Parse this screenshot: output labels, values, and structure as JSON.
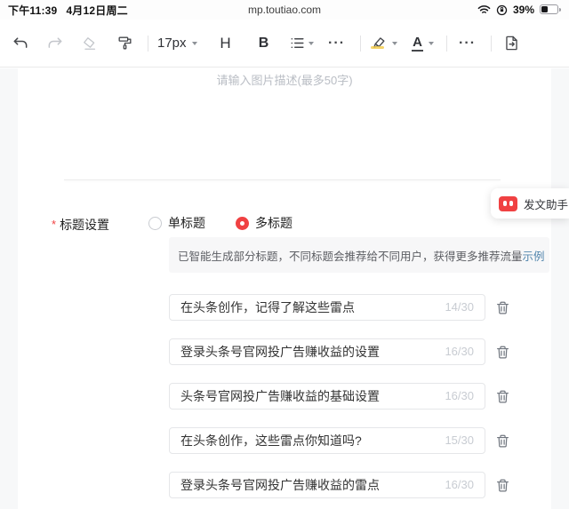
{
  "status_bar": {
    "time": "下午11:39",
    "date": "4月12日周二",
    "url": "mp.toutiao.com",
    "battery_percent": "39%"
  },
  "toolbar": {
    "font_size": "17px",
    "heading_label": "H",
    "bold_label": "B",
    "text_color_label": "A",
    "more_label": "···"
  },
  "editor": {
    "image_caption_placeholder": "请输入图片描述(最多50字)"
  },
  "title_settings": {
    "required_mark": "*",
    "label": "标题设置",
    "options": [
      {
        "label": "单标题",
        "selected": false
      },
      {
        "label": "多标题",
        "selected": true
      }
    ],
    "banner": {
      "text": "已智能生成部分标题，不同标题会推荐给不同用户，获得更多推荐流量",
      "link": "示例"
    },
    "titles": [
      {
        "value": "在头条创作，记得了解这些雷点",
        "counter": "14/30"
      },
      {
        "value": "登录头条号官网投广告赚收益的设置",
        "counter": "16/30"
      },
      {
        "value": "头条号官网投广告赚收益的基础设置",
        "counter": "16/30"
      },
      {
        "value": "在头条创作，这些雷点你知道吗?",
        "counter": "15/30"
      },
      {
        "value": "登录头条号官网投广告赚收益的雷点",
        "counter": "16/30"
      }
    ]
  },
  "assistant_button": {
    "label": "发文助手"
  },
  "colors": {
    "accent_red": "#f04142",
    "link_blue": "#5487ae",
    "banner_bg": "#f7f7f8",
    "highlight_yellow": "#f3cc4e"
  }
}
